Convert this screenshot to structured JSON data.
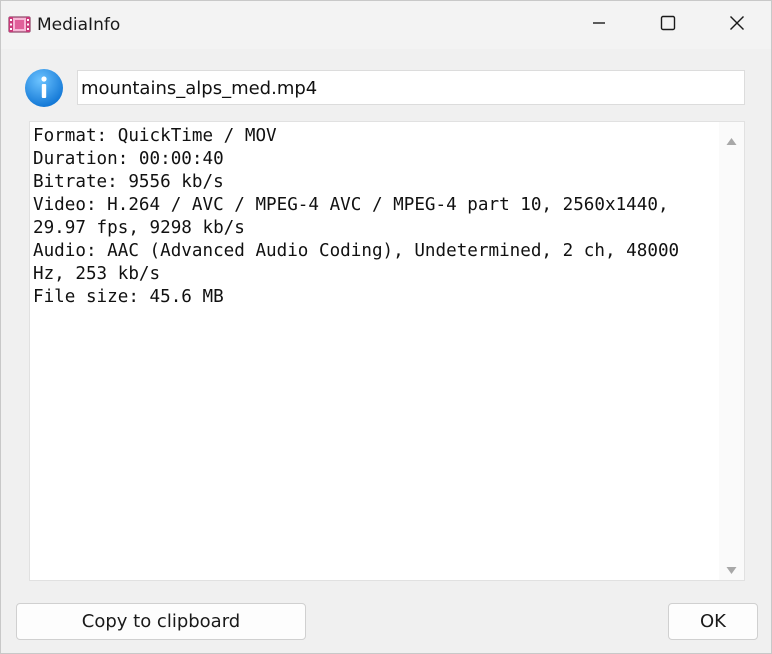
{
  "window": {
    "title": "MediaInfo"
  },
  "icons": {
    "app": "film-strip-icon",
    "info": "info-icon",
    "minimize": "minimize-icon",
    "maximize": "maximize-icon",
    "close": "close-icon",
    "scroll_up": "scroll-up-arrow-icon",
    "scroll_down": "scroll-down-arrow-icon"
  },
  "file": {
    "name": "mountains_alps_med.mp4"
  },
  "info_text": "Format: QuickTime / MOV\nDuration: 00:00:40\nBitrate: 9556 kb/s\nVideo: H.264 / AVC / MPEG-4 AVC / MPEG-4 part 10, 2560x1440, 29.97 fps, 9298 kb/s\nAudio: AAC (Advanced Audio Coding), Undetermined, 2 ch, 48000 Hz, 253 kb/s\nFile size: 45.6 MB",
  "buttons": {
    "copy_label": "Copy to clipboard",
    "ok_label": "OK"
  },
  "colors": {
    "info_blue": "#1e90e6",
    "app_icon_pink": "#e0609a"
  }
}
